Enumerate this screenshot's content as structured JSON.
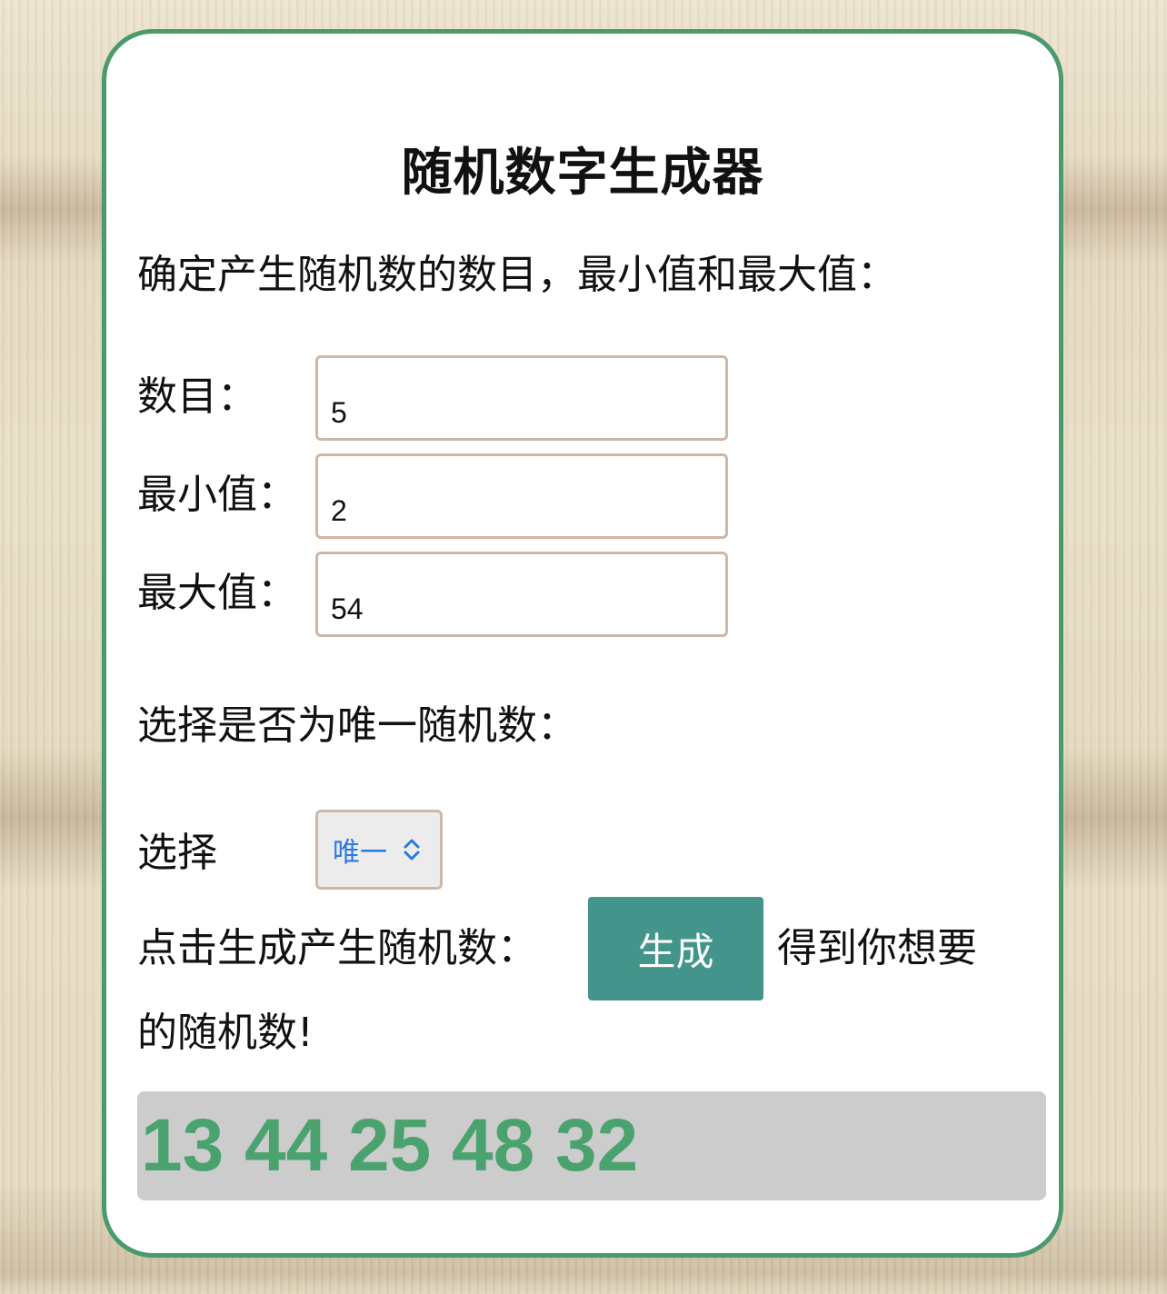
{
  "title": "随机数字生成器",
  "instructions": "确定产生随机数的数目，最小值和最大值：",
  "fields": {
    "count": {
      "label": "数目：",
      "value": "5"
    },
    "min": {
      "label": "最小值：",
      "value": "2"
    },
    "max": {
      "label": "最大值：",
      "value": "54"
    }
  },
  "uniqueness": {
    "prompt": "选择是否为唯一随机数：",
    "label": "选择",
    "selected": "唯一"
  },
  "generate": {
    "prefix": "点击生成产生随机数：",
    "button_label": "生成",
    "suffix_line1": "得到你想要",
    "suffix_line2": "的随机数!"
  },
  "result": "13 44 25 48 32",
  "colors": {
    "card_border": "#4a9a6e",
    "button_bg": "#43948a",
    "result_text": "#4aa36f",
    "result_bg": "#cccccc",
    "select_text": "#2b78e4"
  }
}
